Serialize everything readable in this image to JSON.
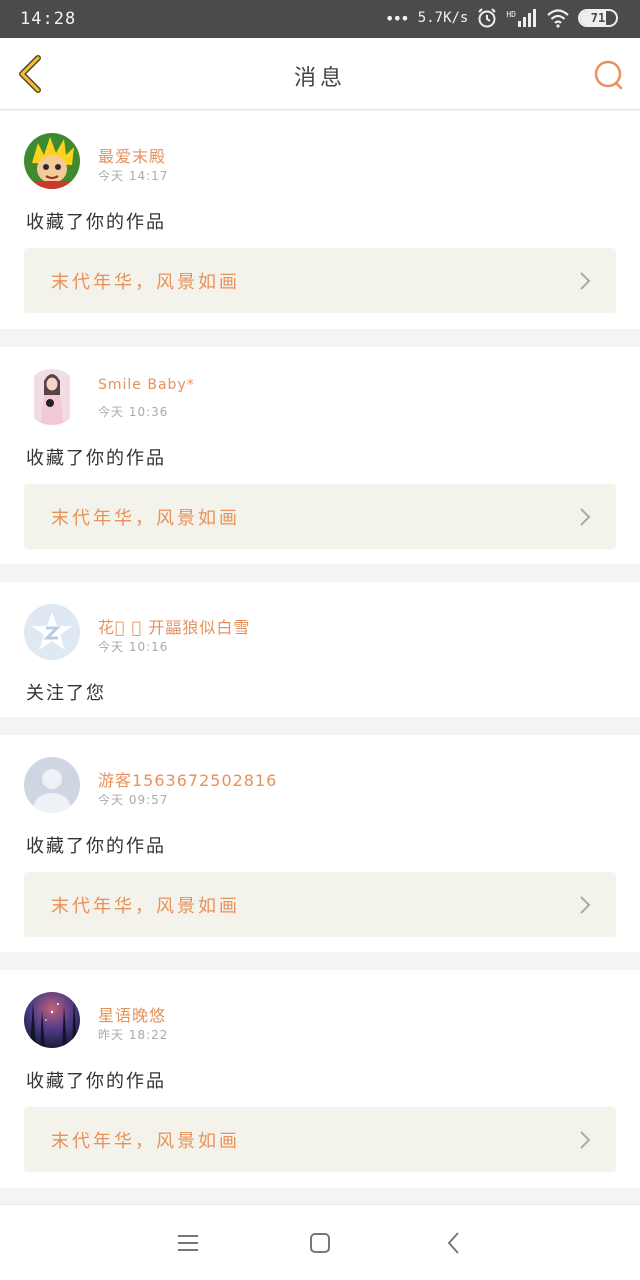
{
  "status_bar": {
    "time": "14:28",
    "net_speed": "5.7K/s",
    "hd_label": "HD",
    "battery": "71"
  },
  "header": {
    "title": "消息",
    "accent_color": "#e8915a"
  },
  "notifications": [
    {
      "username": "最爱末殿",
      "time": "今天 14:17",
      "action": "收藏了你的作品",
      "work": "末代年华，风景如画",
      "avatar": "cartoon-character"
    },
    {
      "username": "Smile Baby*",
      "time": "今天 10:36",
      "action": "收藏了你的作品",
      "work": "末代年华，风景如画",
      "avatar": "photo-girl"
    },
    {
      "username": "花\u0000 \u0000 开㽬狼似白雪",
      "time": "今天 10:16",
      "action": "关注了您",
      "work": "",
      "avatar": "qzone-logo"
    },
    {
      "username": "游客1563672502816",
      "time": "今天 09:57",
      "action": "收藏了你的作品",
      "work": "末代年华，风景如画",
      "avatar": "default-person"
    },
    {
      "username": "星语晚悠",
      "time": "昨天 18:22",
      "action": "收藏了你的作品",
      "work": "末代年华，风景如画",
      "avatar": "forest-night"
    }
  ]
}
